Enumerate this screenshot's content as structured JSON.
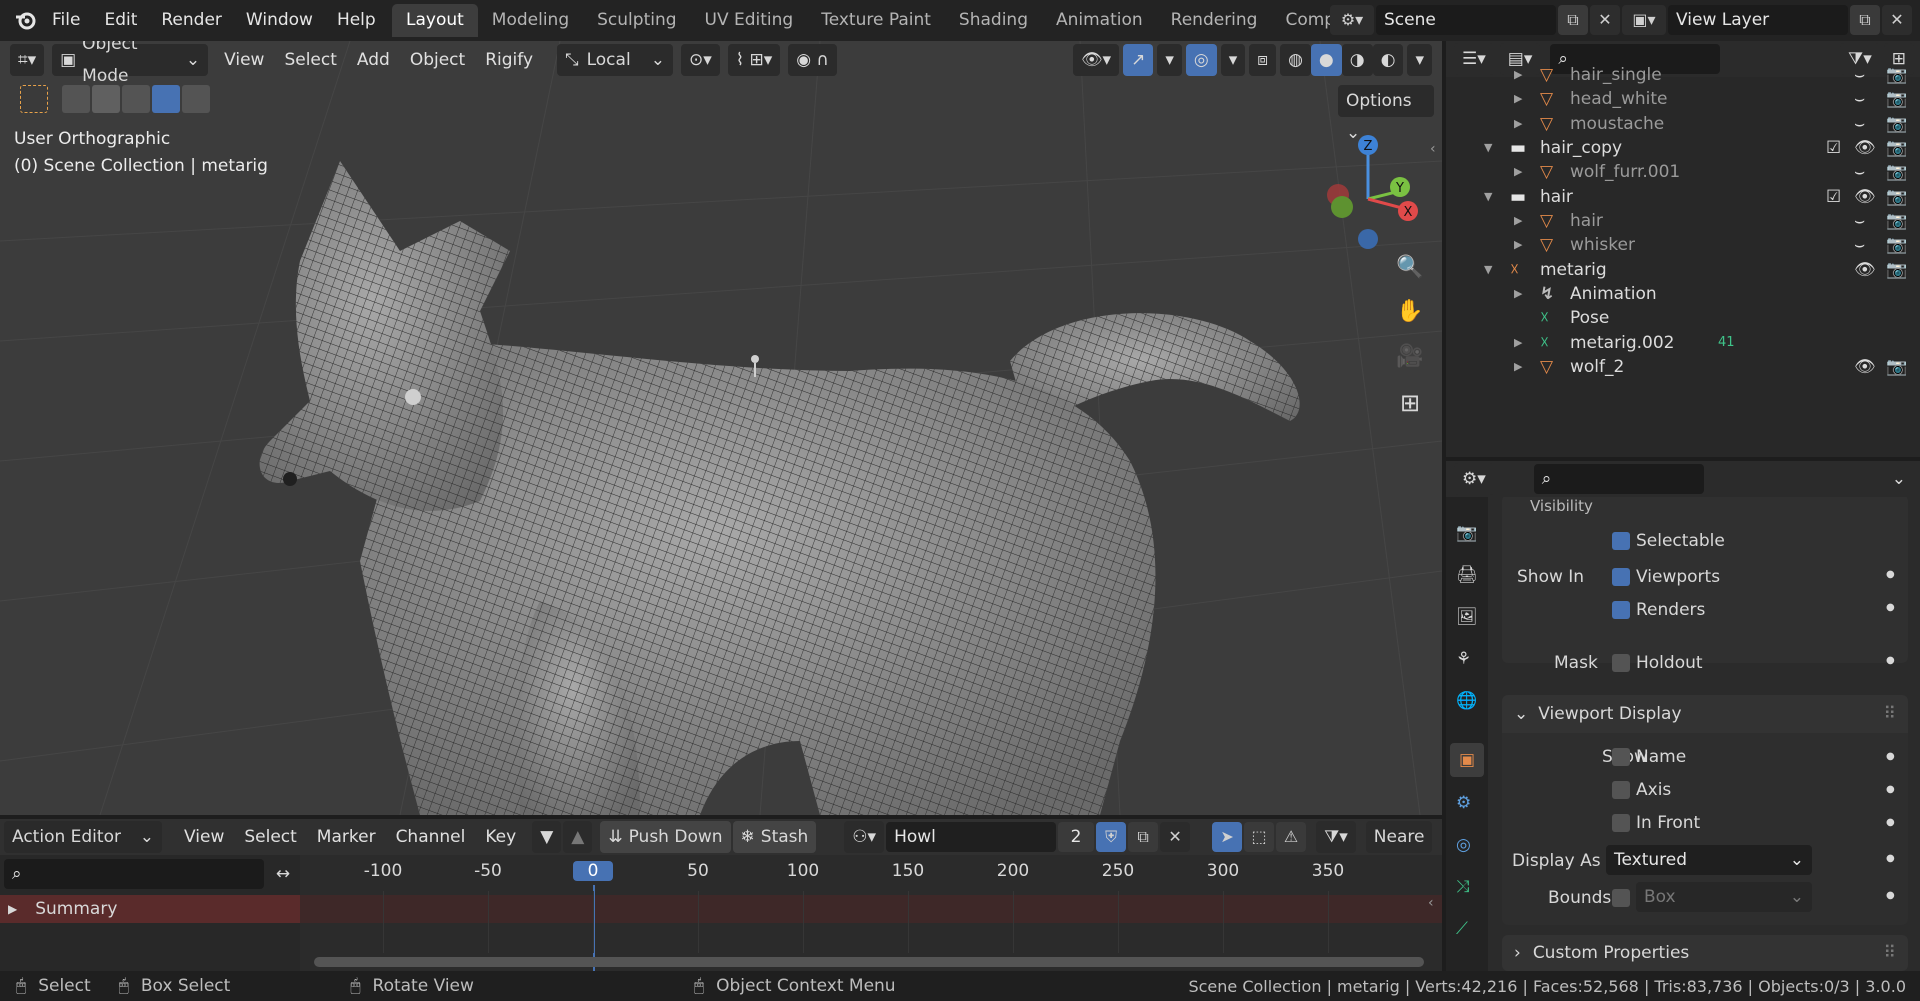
{
  "topbar": {
    "menus": [
      "File",
      "Edit",
      "Render",
      "Window",
      "Help"
    ],
    "workspaces": [
      "Layout",
      "Modeling",
      "Sculpting",
      "UV Editing",
      "Texture Paint",
      "Shading",
      "Animation",
      "Rendering",
      "Compo"
    ],
    "active_workspace": "Layout",
    "scene": "Scene",
    "view_layer": "View Layer"
  },
  "viewport": {
    "mode": "Object Mode",
    "menus": [
      "View",
      "Select",
      "Add",
      "Object",
      "Rigify"
    ],
    "orientation": "Local",
    "options": "Options",
    "overlay_line1": "User Orthographic",
    "overlay_line2": "(0) Scene Collection | metarig",
    "gizmo": {
      "z": "Z",
      "y": "Y",
      "x": "X"
    }
  },
  "outliner": {
    "rows": [
      {
        "label": "hair_single",
        "type": "mesh",
        "dim": true
      },
      {
        "label": "head_white",
        "type": "mesh",
        "dim": true
      },
      {
        "label": "moustache",
        "type": "mesh",
        "dim": true
      },
      {
        "label": "hair_copy",
        "type": "collection",
        "dim": false
      },
      {
        "label": "wolf_furr.001",
        "type": "mesh",
        "dim": true
      },
      {
        "label": "hair",
        "type": "collection",
        "dim": false
      },
      {
        "label": "hair",
        "type": "mesh",
        "dim": true
      },
      {
        "label": "whisker",
        "type": "mesh",
        "dim": true
      },
      {
        "label": "metarig",
        "type": "armature",
        "dim": false
      },
      {
        "label": "Animation",
        "type": "anim",
        "dim": false
      },
      {
        "label": "Pose",
        "type": "pose",
        "dim": false
      },
      {
        "label": "metarig.002",
        "type": "armdata",
        "dim": false,
        "badge": "41"
      },
      {
        "label": "wolf_2",
        "type": "mesh",
        "dim": false
      }
    ]
  },
  "properties": {
    "visibility_header": "Visibility",
    "selectable": "Selectable",
    "show_in": "Show In",
    "viewports": "Viewports",
    "renders": "Renders",
    "mask": "Mask",
    "holdout": "Holdout",
    "viewport_display": "Viewport Display",
    "show": "Show",
    "name": "Name",
    "axis": "Axis",
    "in_front": "In Front",
    "display_as": "Display As",
    "display_as_value": "Textured",
    "bounds": "Bounds",
    "bounds_value": "Box",
    "custom_properties": "Custom Properties"
  },
  "action_editor": {
    "editor": "Action Editor",
    "menus": [
      "View",
      "Select",
      "Marker",
      "Channel",
      "Key"
    ],
    "push_down": "Push Down",
    "stash": "Stash",
    "action_name": "Howl",
    "users": "2",
    "nearest": "Neare",
    "ticks": [
      "-100",
      "-50",
      "0",
      "50",
      "100",
      "150",
      "200",
      "250",
      "300",
      "350"
    ],
    "current_frame": "0",
    "summary": "Summary"
  },
  "statusbar": {
    "select": "Select",
    "box_select": "Box Select",
    "rotate_view": "Rotate View",
    "context_menu": "Object Context Menu",
    "stats": "Scene Collection | metarig | Verts:42,216 | Faces:52,568 | Tris:83,736 | Objects:0/3 | 3.0.0"
  },
  "colors": {
    "accent": "#4772b3",
    "mesh_icon": "#e38a4a",
    "data_icon": "#3fc48a",
    "timeline_current": "#4772b3"
  }
}
